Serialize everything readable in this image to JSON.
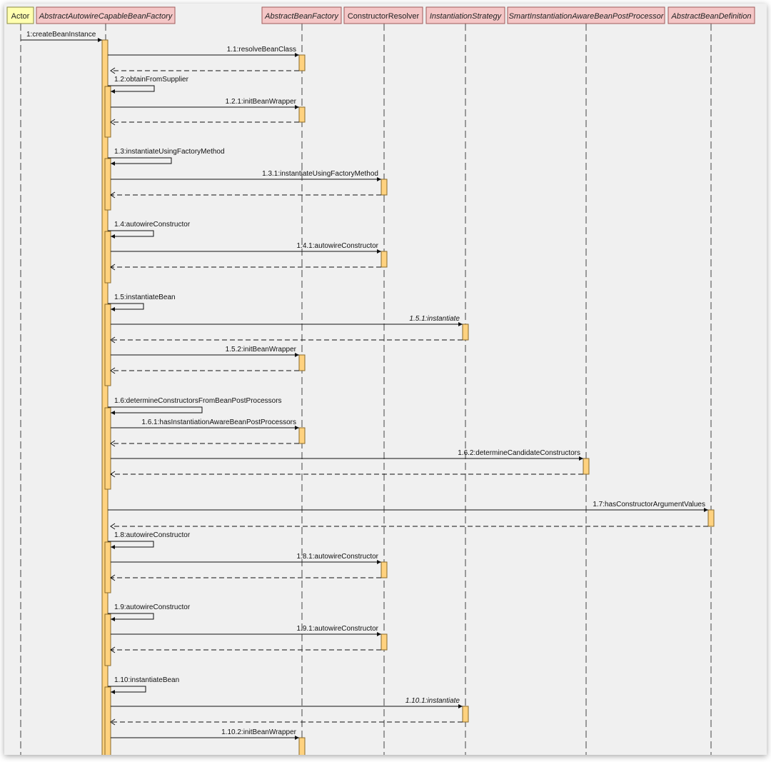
{
  "participants": [
    {
      "id": "actor",
      "label": "Actor",
      "kind": "actor",
      "italic": false
    },
    {
      "id": "aacbf",
      "label": "AbstractAutowireCapableBeanFactory",
      "kind": "abstract",
      "italic": true
    },
    {
      "id": "abf",
      "label": "AbstractBeanFactory",
      "kind": "abstract",
      "italic": true
    },
    {
      "id": "cr",
      "label": "ConstructorResolver",
      "kind": "class",
      "italic": false
    },
    {
      "id": "is",
      "label": "InstantiationStrategy",
      "kind": "interface",
      "italic": true
    },
    {
      "id": "siabpp",
      "label": "SmartInstantiationAwareBeanPostProcessor",
      "kind": "interface",
      "italic": true
    },
    {
      "id": "abd",
      "label": "AbstractBeanDefinition",
      "kind": "abstract",
      "italic": true
    }
  ],
  "messages": [
    {
      "label": "1:createBeanInstance",
      "from": "actor",
      "to": "aacbf",
      "italic": false
    },
    {
      "label": "1.1:resolveBeanClass",
      "from": "aacbf",
      "to": "abf",
      "italic": false
    },
    {
      "label": "1.2:obtainFromSupplier",
      "from": "aacbf",
      "to": "aacbf",
      "italic": false
    },
    {
      "label": "1.2.1:initBeanWrapper",
      "from": "aacbf",
      "to": "abf",
      "italic": false
    },
    {
      "label": "1.3:instantiateUsingFactoryMethod",
      "from": "aacbf",
      "to": "aacbf",
      "italic": false
    },
    {
      "label": "1.3.1:instantiateUsingFactoryMethod",
      "from": "aacbf",
      "to": "cr",
      "italic": false
    },
    {
      "label": "1.4:autowireConstructor",
      "from": "aacbf",
      "to": "aacbf",
      "italic": false
    },
    {
      "label": "1.4.1:autowireConstructor",
      "from": "aacbf",
      "to": "cr",
      "italic": false
    },
    {
      "label": "1.5:instantiateBean",
      "from": "aacbf",
      "to": "aacbf",
      "italic": false
    },
    {
      "label": "1.5.1:instantiate",
      "from": "aacbf",
      "to": "is",
      "italic": true
    },
    {
      "label": "1.5.2:initBeanWrapper",
      "from": "aacbf",
      "to": "abf",
      "italic": false
    },
    {
      "label": "1.6:determineConstructorsFromBeanPostProcessors",
      "from": "aacbf",
      "to": "aacbf",
      "italic": false
    },
    {
      "label": "1.6.1:hasInstantiationAwareBeanPostProcessors",
      "from": "aacbf",
      "to": "abf",
      "italic": false
    },
    {
      "label": "1.6.2:determineCandidateConstructors",
      "from": "aacbf",
      "to": "siabpp",
      "italic": false
    },
    {
      "label": "1.7:hasConstructorArgumentValues",
      "from": "aacbf",
      "to": "abd",
      "italic": false
    },
    {
      "label": "1.8:autowireConstructor",
      "from": "aacbf",
      "to": "aacbf",
      "italic": false
    },
    {
      "label": "1.8.1:autowireConstructor",
      "from": "aacbf",
      "to": "cr",
      "italic": false
    },
    {
      "label": "1.9:autowireConstructor",
      "from": "aacbf",
      "to": "aacbf",
      "italic": false
    },
    {
      "label": "1.9.1:autowireConstructor",
      "from": "aacbf",
      "to": "cr",
      "italic": false
    },
    {
      "label": "1.10:instantiateBean",
      "from": "aacbf",
      "to": "aacbf",
      "italic": false
    },
    {
      "label": "1.10.1:instantiate",
      "from": "aacbf",
      "to": "is",
      "italic": true
    },
    {
      "label": "1.10.2:initBeanWrapper",
      "from": "aacbf",
      "to": "abf",
      "italic": false
    }
  ],
  "colors": {
    "actor_fill": "#ffffb0",
    "participant_fill": "#f4c6c6",
    "participant_border": "#a05a5a",
    "activation_fill": "#ffd27f",
    "activation_border": "#8a6a2a",
    "line": "#333333",
    "frame_bg": "#f0f0f0"
  }
}
